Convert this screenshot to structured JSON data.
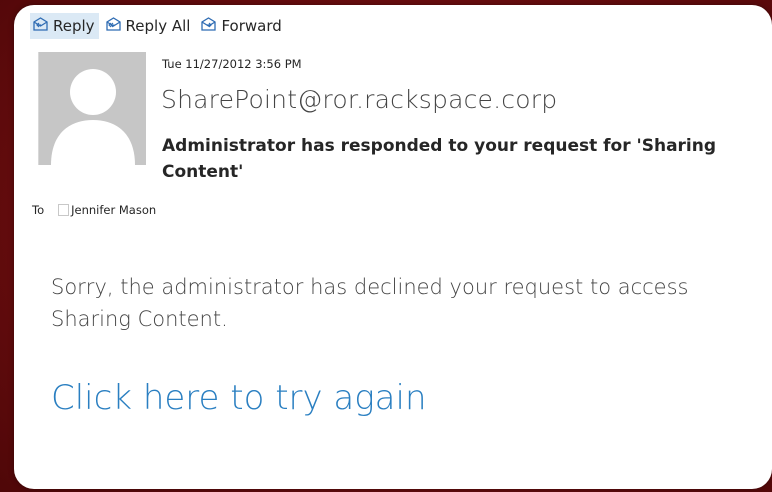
{
  "toolbar": {
    "reply_label": "Reply",
    "reply_all_label": "Reply All",
    "forward_label": "Forward"
  },
  "message": {
    "date": "Tue 11/27/2012 3:56 PM",
    "sender": "SharePoint@ror.rackspace.corp",
    "subject": "Administrator has responded to your request for 'Sharing Content'",
    "to_label": "To",
    "recipient": "Jennifer Mason",
    "body": "Sorry, the administrator has declined your request to access Sharing Content.",
    "link_text": "Click here to try again"
  },
  "icons": {
    "reply": "reply-envelope-icon",
    "reply_all": "reply-all-envelope-icon",
    "forward": "forward-envelope-icon",
    "avatar": "person-silhouette-icon"
  },
  "colors": {
    "background": "#6e0f10",
    "link": "#2a7fc1",
    "icon_accent": "#2f6cb3",
    "active_button": "#dbe9f5"
  }
}
